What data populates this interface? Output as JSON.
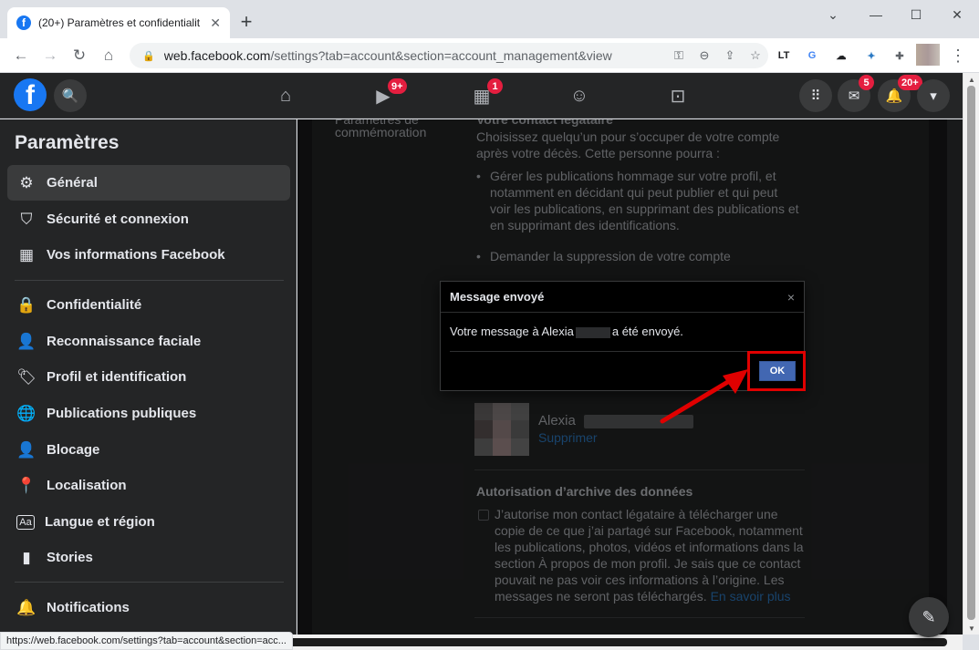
{
  "browser": {
    "tab_title": "(20+) Paramètres et confidentialit",
    "tab_favicon": "f",
    "url_host": "web.facebook.com",
    "url_path": "/settings?tab=account&section=account_management&view",
    "status_url": "https://web.facebook.com/settings?tab=account&section=acc...",
    "extensions": [
      "LT",
      "G",
      "☁",
      "✦",
      "✚"
    ]
  },
  "topbar": {
    "logo": "f",
    "video_badge": "9+",
    "marketplace_badge": "1",
    "messenger_badge": "5",
    "notifications_badge": "20+"
  },
  "sidebar": {
    "title": "Paramètres",
    "items": [
      {
        "label": "Général",
        "icon": "gear-icon"
      },
      {
        "label": "Sécurité et connexion",
        "icon": "shield-icon"
      },
      {
        "label": "Vos informations Facebook",
        "icon": "grid-icon"
      },
      {
        "label": "Confidentialité",
        "icon": "lock-icon"
      },
      {
        "label": "Reconnaissance faciale",
        "icon": "face-icon"
      },
      {
        "label": "Profil et identification",
        "icon": "tag-icon"
      },
      {
        "label": "Publications publiques",
        "icon": "globe-icon"
      },
      {
        "label": "Blocage",
        "icon": "block-user-icon"
      },
      {
        "label": "Localisation",
        "icon": "location-pin-icon"
      },
      {
        "label": "Langue et région",
        "icon": "language-icon"
      },
      {
        "label": "Stories",
        "icon": "stories-icon"
      },
      {
        "label": "Notifications",
        "icon": "bell-icon"
      }
    ]
  },
  "main": {
    "side_label_top": "Paramètres de",
    "side_label": "commémoration",
    "section_heading": "Votre contact légataire",
    "intro": "Choisissez quelqu’un pour s’occuper de votre compte après votre décès. Cette personne pourra :",
    "bullet1": "Gérer les publications hommage sur votre profil, et notamment en décidant qui peut publier et qui peut voir les publications, en supprimant des publications et en supprimant des identifications.",
    "bullet2": "Demander la suppression de votre compte",
    "contact_name": "Alexia",
    "contact_remove": "Supprimer",
    "archive_heading": "Autorisation d’archive des données",
    "archive_text": "J’autorise mon contact légataire à télécharger une copie de ce que j’ai partagé sur Facebook, notamment les publications, photos, vidéos et informations dans la section À propos de mon profil. Je sais que ce contact pouvait ne pas voir ces informations à l’origine. Les messages ne seront pas téléchargés.",
    "learn_more": "En savoir plus"
  },
  "dialog": {
    "title": "Message envoyé",
    "close": "×",
    "body_prefix": "Votre message à Alexia",
    "body_suffix": "a été envoyé.",
    "ok_label": "OK"
  },
  "colors": {
    "fb_blue": "#1877f2",
    "badge_red": "#e41e3f",
    "annotation_red": "#e00000",
    "ok_button": "#4267b2"
  }
}
